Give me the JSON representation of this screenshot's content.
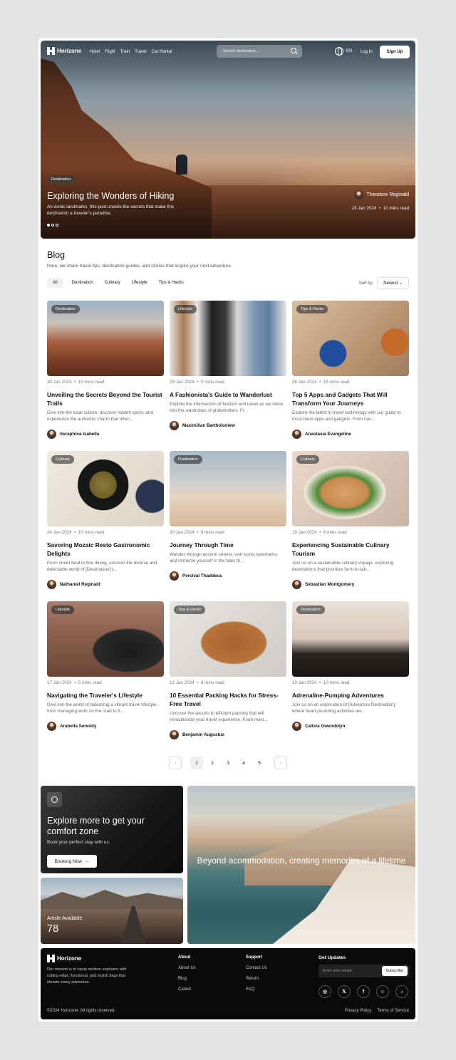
{
  "nav": {
    "brand": "Horizone",
    "links": [
      "Hotel",
      "Flight",
      "Train",
      "Travel",
      "Car Rental"
    ],
    "search_placeholder": "Search destination...",
    "lang": "EN",
    "login": "Log In",
    "signup": "Sign Up"
  },
  "hero": {
    "tag": "Destination",
    "title": "Exploring the Wonders of Hiking",
    "desc": "An iconic landmarks, this post unveils the secrets that make this destination a traveler's paradise.",
    "author": "Theodore Reginald",
    "date": "24 Jan 2024",
    "read": "10 mins read"
  },
  "blog": {
    "title": "Blog",
    "subtitle": "Here, we share travel tips, destination guides, and stories that inspire your next adventure.",
    "filters": [
      "All",
      "Destination",
      "Culinary",
      "Lifestyle",
      "Tips & Hacks"
    ],
    "sort_label": "Sort by:",
    "sort_value": "Newest"
  },
  "cards": [
    {
      "tag": "Destination",
      "date": "30 Jan 2024",
      "read": "10 mins read",
      "title": "Unveiling the Secrets Beyond the Tourist Trails",
      "desc": "Dive into the local culture, discover hidden spots, and experience the authentic charm that often...",
      "author": "Seraphina Isabella"
    },
    {
      "tag": "Lifestyle",
      "date": "29 Jan 2024",
      "read": "5 mins read",
      "title": "A Fashionista's Guide to Wanderlust",
      "desc": "Explore the intersection of fashion and travel as we delve into the wardrobes of globetrotters. Fr...",
      "author": "Maximilian Bartholomew"
    },
    {
      "tag": "Tips & Hacks",
      "date": "26 Jan 2024",
      "read": "15 mins read",
      "title": "Top 5 Apps and Gadgets That Will Transform Your Journeys",
      "desc": "Explore the latest in travel technology with our guide to must-have apps and gadgets. From nav...",
      "author": "Anastasia Evangeline"
    },
    {
      "tag": "Culinary",
      "date": "24 Jan 2024",
      "read": "10 mins read",
      "title": "Savoring Mozaic Resto Gastronomic Delights",
      "desc": "From street food to fine dining, uncover the diverse and delectable world of [Destination]'s...",
      "author": "Nathaniel Reginald"
    },
    {
      "tag": "Destination",
      "date": "20 Jan 2024",
      "read": "8 mins read",
      "title": "Journey Through Time",
      "desc": "Wander through ancient streets, visit iconic landmarks, and immerse yourself in the tales th...",
      "author": "Percival Thaddeus"
    },
    {
      "tag": "Culinary",
      "date": "18 Jan 2024",
      "read": "6 mins read",
      "title": "Experiencing Sustainable Culinary Tourism",
      "desc": "Join us on a sustainable culinary voyage, exploring destinations that prioritize farm-to-tab...",
      "author": "Sebastian Montgomery"
    },
    {
      "tag": "Lifestyle",
      "date": "17 Jan 2024",
      "read": "5 mins read",
      "title": "Navigating the Traveler's Lifestyle",
      "desc": "Dive into the world of balancing a vibrant travel lifestyle - from managing work on the road to fi...",
      "author": "Arabella Serenity"
    },
    {
      "tag": "Tips & Hacks",
      "date": "12 Jan 2024",
      "read": "8 mins read",
      "title": "10 Essential Packing Hacks for Stress-Free Travel",
      "desc": "Uncover the secrets to efficient packing that will revolutionize your travel experience. From maxi...",
      "author": "Benjamin Augustus"
    },
    {
      "tag": "Destination",
      "date": "10 Jan 2024",
      "read": "10 mins read",
      "title": "Adrenaline-Pumping Adventures",
      "desc": "Join us on an exploration of [Adventure Destination], where heart-pounding activities aw...",
      "author": "Calista Gwendolyn"
    }
  ],
  "pager": {
    "prev": "‹",
    "pages": [
      "1",
      "2",
      "3",
      "4",
      "5"
    ],
    "next": "›"
  },
  "promo": {
    "title": "Explore more to get your comfort zone",
    "sub": "Book your perfect stay with us.",
    "button": "Booking Now",
    "arrow": "→"
  },
  "article": {
    "label": "Article Available",
    "count": "78"
  },
  "banner": {
    "text": "Beyond acommodation, creating memories of a lifetime"
  },
  "footer": {
    "brand": "Horizone",
    "desc": "Our mission is to equip modern explorers with cutting-edge, functional, and stylish bags that elevate every adventure.",
    "cols": [
      {
        "title": "About",
        "items": [
          "About Us",
          "Blog",
          "Career"
        ]
      },
      {
        "title": "Support",
        "items": [
          "Contact Us",
          "Return",
          "FAQ"
        ]
      }
    ],
    "updates": "Get Updates",
    "email_placeholder": "Enter your email",
    "subscribe": "Subscribe",
    "socials": [
      "instagram-icon",
      "x-icon",
      "facebook-icon",
      "discord-icon",
      "tiktok-icon"
    ],
    "copyright": "©2024 Horizone. All rights reserved.",
    "privacy": "Privacy Policy",
    "terms": "Terms  of Service"
  }
}
